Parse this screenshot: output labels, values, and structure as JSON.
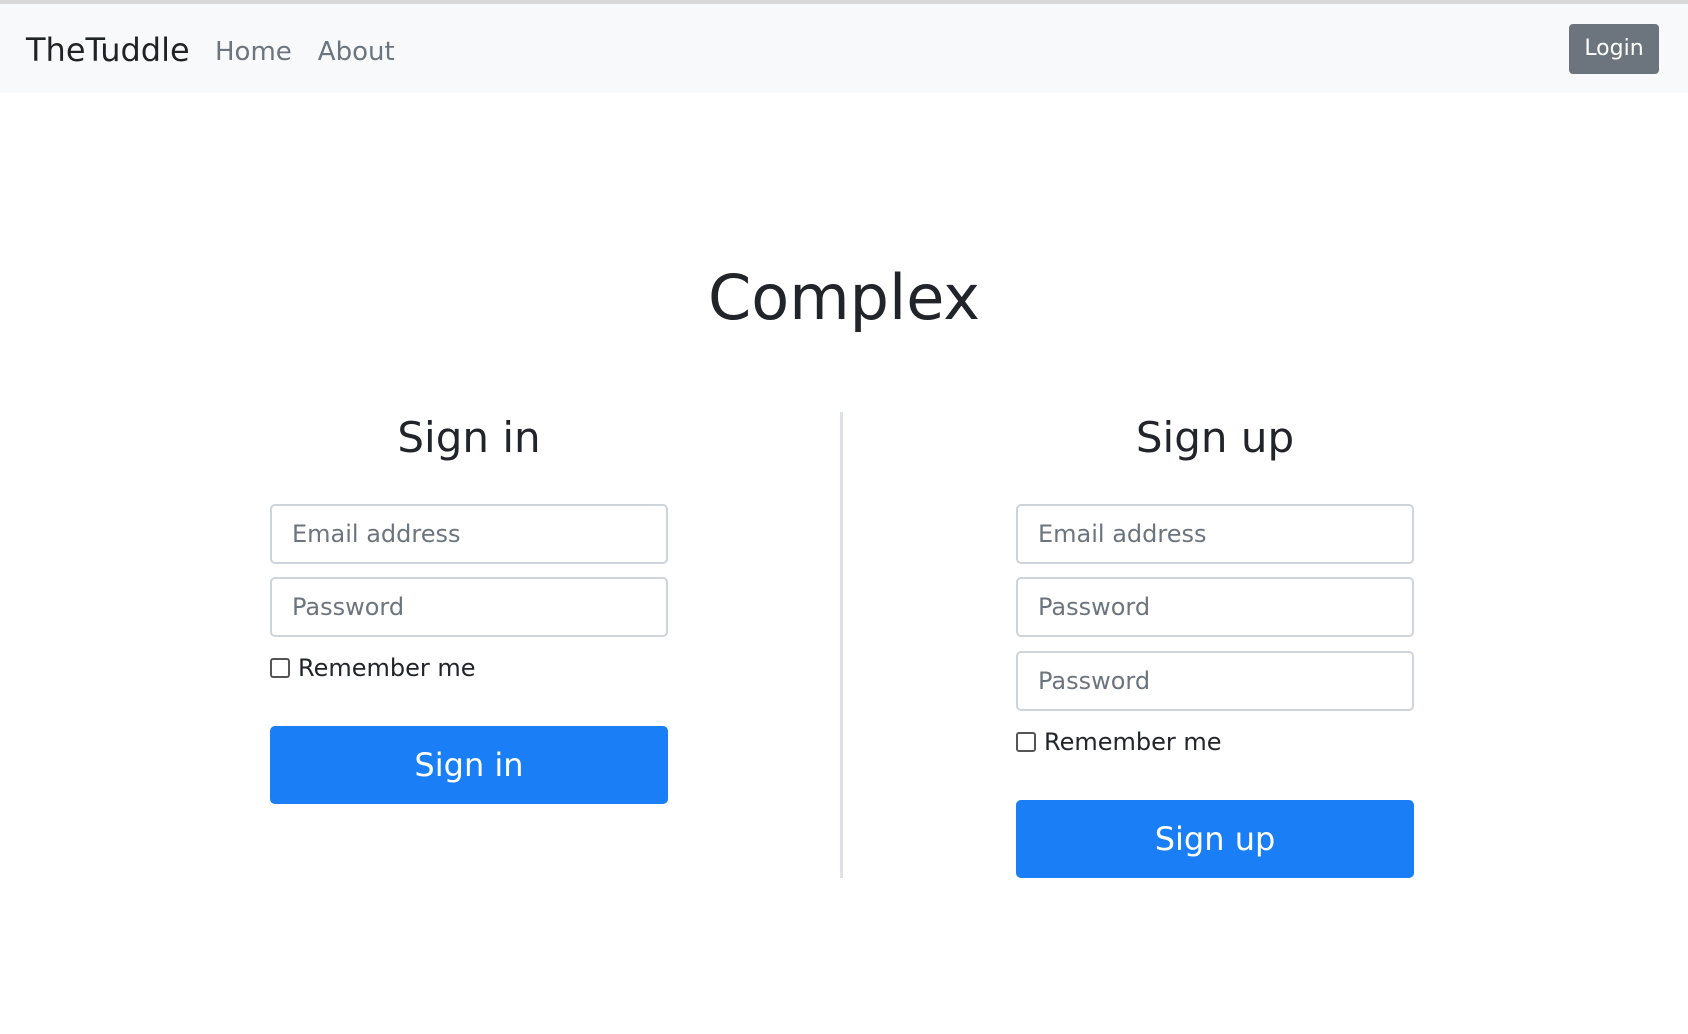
{
  "navbar": {
    "brand": "TheTuddle",
    "links": [
      "Home",
      "About"
    ],
    "login_label": "Login"
  },
  "page": {
    "title": "Complex"
  },
  "signin": {
    "title": "Sign in",
    "email_placeholder": "Email address",
    "password_placeholder": "Password",
    "remember_label": "Remember me",
    "button_label": "Sign in"
  },
  "signup": {
    "title": "Sign up",
    "email_placeholder": "Email address",
    "password_placeholder": "Password",
    "confirm_password_placeholder": "Password",
    "remember_label": "Remember me",
    "button_label": "Sign up"
  },
  "colors": {
    "primary": "#1a7ef7",
    "secondary": "#6c757d",
    "navbar_bg": "#f8f9fa"
  }
}
